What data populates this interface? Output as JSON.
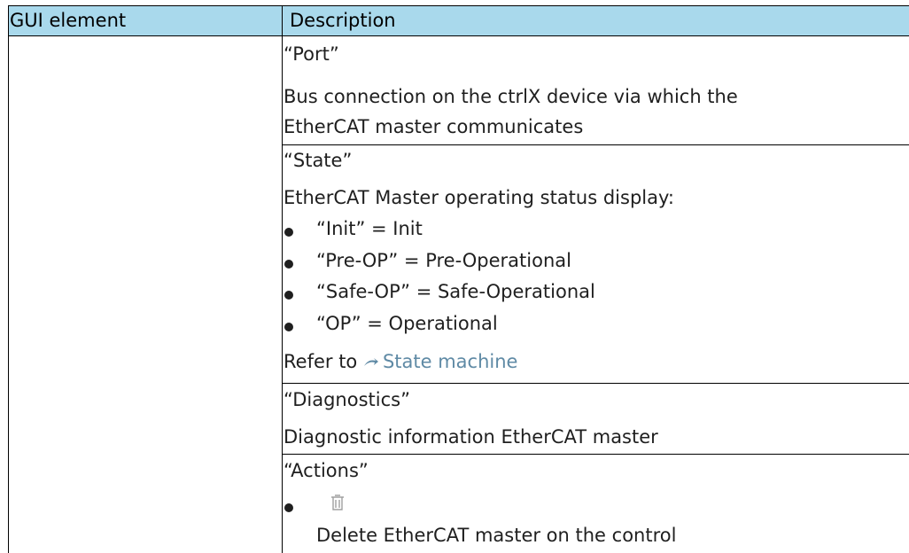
{
  "table": {
    "headers": [
      "GUI element",
      "Description"
    ],
    "rows": [
      {
        "title": "“Port”",
        "description": [
          "Bus connection on the ctrlX device via which the",
          "EtherCAT master communicates"
        ]
      },
      {
        "title": "“State”",
        "description": [
          "EtherCAT Master operating status display:"
        ],
        "states": [
          "“Init” = Init",
          "“Pre-OP” = Pre-Operational",
          "“Safe-OP” = Safe-Operational",
          "“OP” = Operational"
        ],
        "refer_prefix": "Refer to ",
        "refer_link": "State machine"
      },
      {
        "title": "“Diagnostics”",
        "description": [
          "Diagnostic information EtherCAT master"
        ]
      },
      {
        "title": "“Actions”",
        "actions": [
          {
            "icon": "trash-icon",
            "label": "Delete EtherCAT master on the control"
          }
        ]
      }
    ]
  }
}
